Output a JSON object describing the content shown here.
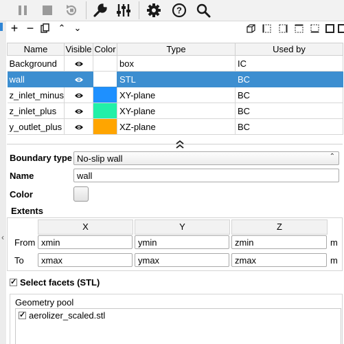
{
  "table": {
    "headers": [
      "Name",
      "Visible",
      "Color",
      "Type",
      "Used by"
    ],
    "rows": [
      {
        "name": "Background",
        "type": "box",
        "used_by": "IC",
        "color": "",
        "selected": false
      },
      {
        "name": "wall",
        "type": "STL",
        "used_by": "BC",
        "color": "",
        "selected": true
      },
      {
        "name": "z_inlet_minus",
        "type": "XY-plane",
        "used_by": "BC",
        "color": "#1e90ff",
        "selected": false
      },
      {
        "name": "z_inlet_plus",
        "type": "XY-plane",
        "used_by": "BC",
        "color": "#22f0a8",
        "selected": false
      },
      {
        "name": "y_outlet_plus",
        "type": "XZ-plane",
        "used_by": "BC",
        "color": "#ffa500",
        "selected": false
      }
    ]
  },
  "form": {
    "boundary_type_label": "Boundary type",
    "boundary_type_value": "No-slip wall",
    "name_label": "Name",
    "name_value": "wall",
    "color_label": "Color",
    "extents_label": "Extents",
    "col_x": "X",
    "col_y": "Y",
    "col_z": "Z",
    "from_label": "From",
    "to_label": "To",
    "unit": "m",
    "from": [
      "xmin",
      "ymin",
      "zmin"
    ],
    "to": [
      "xmax",
      "ymax",
      "zmax"
    ],
    "select_facets_label": "Select facets (STL)",
    "geometry_pool_label": "Geometry pool",
    "pool_items": [
      "aerolizer_scaled.stl"
    ]
  },
  "icons": {
    "toolbar": [
      "pause-icon",
      "stop-icon",
      "reset-icon",
      "wrench-icon",
      "sliders-icon",
      "gear-icon",
      "help-icon",
      "search-icon"
    ],
    "geometry_toolbar": [
      "add-icon",
      "remove-icon",
      "copy-icon",
      "move-up-icon",
      "move-down-icon"
    ]
  },
  "colors": {
    "selection": "#3c8ed0",
    "checkmark": "✓"
  }
}
